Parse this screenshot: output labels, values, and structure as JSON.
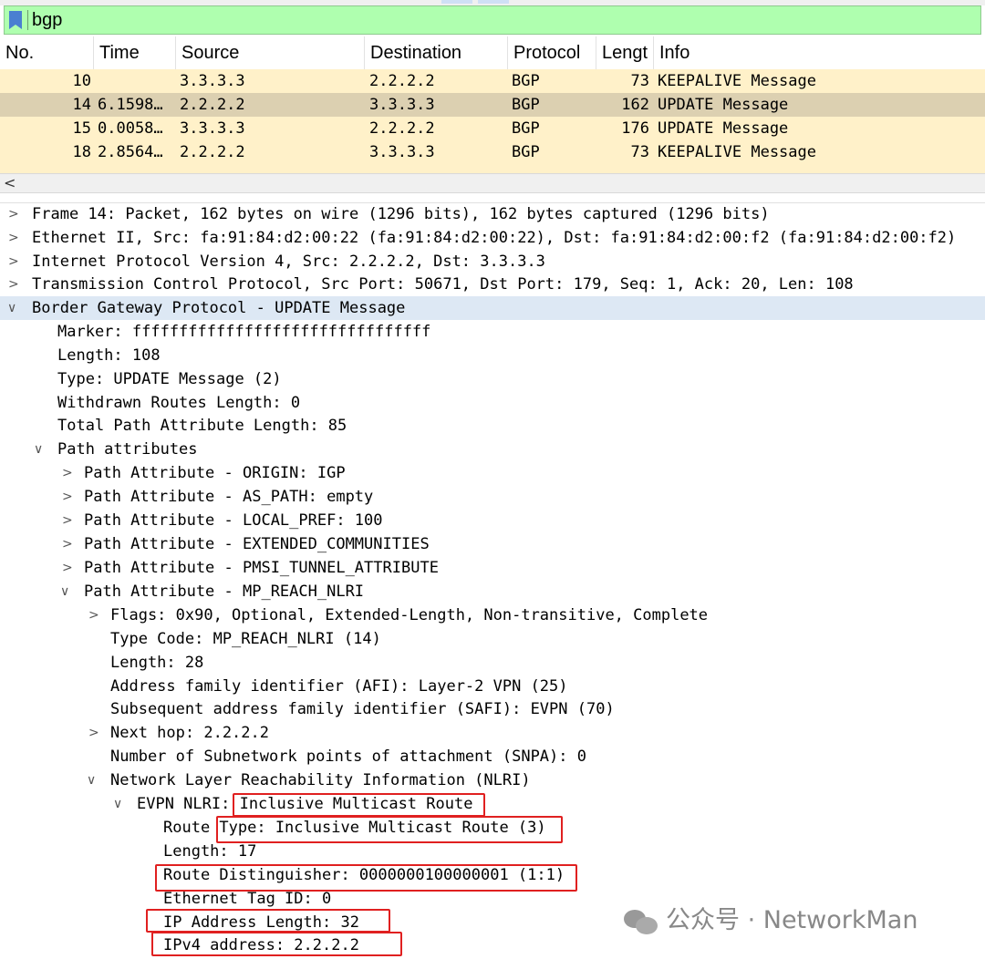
{
  "filter": {
    "icon": "bookmark-icon",
    "value": "bgp"
  },
  "columns": [
    "No.",
    "Time",
    "Source",
    "Destination",
    "Protocol",
    "Lengt",
    "Info"
  ],
  "packets": [
    {
      "no": "10",
      "time": "",
      "source": "3.3.3.3",
      "destination": "2.2.2.2",
      "protocol": "BGP",
      "length": "73",
      "info": "KEEPALIVE Message"
    },
    {
      "no": "14",
      "time": "6.1598…",
      "source": "2.2.2.2",
      "destination": "3.3.3.3",
      "protocol": "BGP",
      "length": "162",
      "info": "UPDATE Message"
    },
    {
      "no": "15",
      "time": "0.0058…",
      "source": "3.3.3.3",
      "destination": "2.2.2.2",
      "protocol": "BGP",
      "length": "176",
      "info": "UPDATE Message"
    },
    {
      "no": "18",
      "time": "2.8564…",
      "source": "2.2.2.2",
      "destination": "3.3.3.3",
      "protocol": "BGP",
      "length": "73",
      "info": "KEEPALIVE Message"
    }
  ],
  "details": {
    "frame": "Frame 14: Packet, 162 bytes on wire (1296 bits), 162 bytes captured (1296 bits)",
    "ethernet": "Ethernet II, Src: fa:91:84:d2:00:22 (fa:91:84:d2:00:22), Dst: fa:91:84:d2:00:f2 (fa:91:84:d2:00:f2)",
    "ip": "Internet Protocol Version 4, Src: 2.2.2.2, Dst: 3.3.3.3",
    "tcp": "Transmission Control Protocol, Src Port: 50671, Dst Port: 179, Seq: 1, Ack: 20, Len: 108",
    "bgp": "Border Gateway Protocol - UPDATE Message",
    "marker": "Marker: ffffffffffffffffffffffffffffffff",
    "length": "Length: 108",
    "type": "Type: UPDATE Message (2)",
    "withdrawn": "Withdrawn Routes Length: 0",
    "total_path": "Total Path Attribute Length: 85",
    "path_attrs": "Path attributes",
    "attr_origin": "Path Attribute - ORIGIN: IGP",
    "attr_aspath": "Path Attribute - AS_PATH: empty",
    "attr_localpref": "Path Attribute - LOCAL_PREF: 100",
    "attr_extcomm": "Path Attribute - EXTENDED_COMMUNITIES",
    "attr_pmsi": "Path Attribute - PMSI_TUNNEL_ATTRIBUTE",
    "attr_mpreach": "Path Attribute - MP_REACH_NLRI",
    "flags": "Flags: 0x90, Optional, Extended-Length, Non-transitive, Complete",
    "type_code": "Type Code: MP_REACH_NLRI (14)",
    "mp_length": "Length: 28",
    "afi": "Address family identifier (AFI): Layer-2 VPN (25)",
    "safi": "Subsequent address family identifier (SAFI): EVPN (70)",
    "next_hop": "Next hop: 2.2.2.2",
    "snpa": "Number of Subnetwork points of attachment (SNPA): 0",
    "nlri": "Network Layer Reachability Information (NLRI)",
    "evpn_nlri": "EVPN NLRI: Inclusive Multicast Route",
    "route_type": "Route Type: Inclusive Multicast Route (3)",
    "route_length": "Length: 17",
    "rd": "Route Distinguisher: 0000000100000001 (1:1)",
    "eth_tag": "Ethernet Tag ID: 0",
    "ip_addr_len": "IP Address Length: 32",
    "ipv4": "IPv4 address: 2.2.2.2"
  },
  "watermark": "公众号 · NetworkMan",
  "colors": {
    "filter_bg": "#afffaf",
    "row_bg": "#fff1c9",
    "row_selected": "#dcd0b1",
    "highlight": "#dde8f4",
    "annotation": "#e02020"
  }
}
